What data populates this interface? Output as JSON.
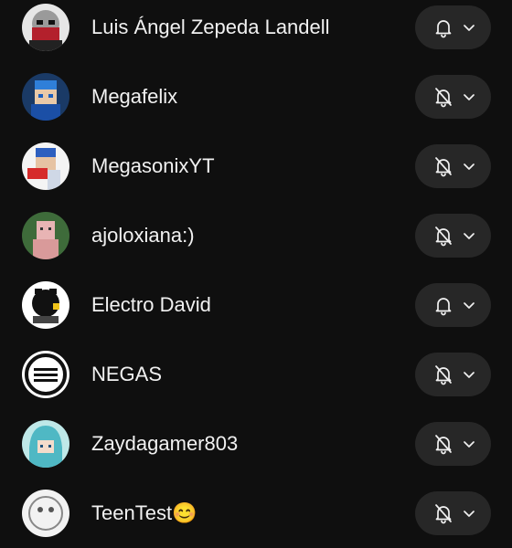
{
  "channels": [
    {
      "name": "Luis Ángel Zepeda Landell",
      "notification": "all",
      "bell_icon": "bell-icon"
    },
    {
      "name": "Megafelix",
      "notification": "none",
      "bell_icon": "bell-off-icon"
    },
    {
      "name": "MegasonixYT",
      "notification": "none",
      "bell_icon": "bell-off-icon"
    },
    {
      "name": "ajoloxiana:)",
      "notification": "none",
      "bell_icon": "bell-off-icon"
    },
    {
      "name": "Electro David",
      "notification": "all",
      "bell_icon": "bell-icon"
    },
    {
      "name": "NEGAS",
      "notification": "none",
      "bell_icon": "bell-off-icon"
    },
    {
      "name": "Zaydagamer803",
      "notification": "none",
      "bell_icon": "bell-off-icon"
    },
    {
      "name": "TeenTest😊",
      "notification": "none",
      "bell_icon": "bell-off-icon"
    }
  ],
  "colors": {
    "background": "#0f0f0f",
    "button": "#272727",
    "text": "#f1f1f1"
  }
}
